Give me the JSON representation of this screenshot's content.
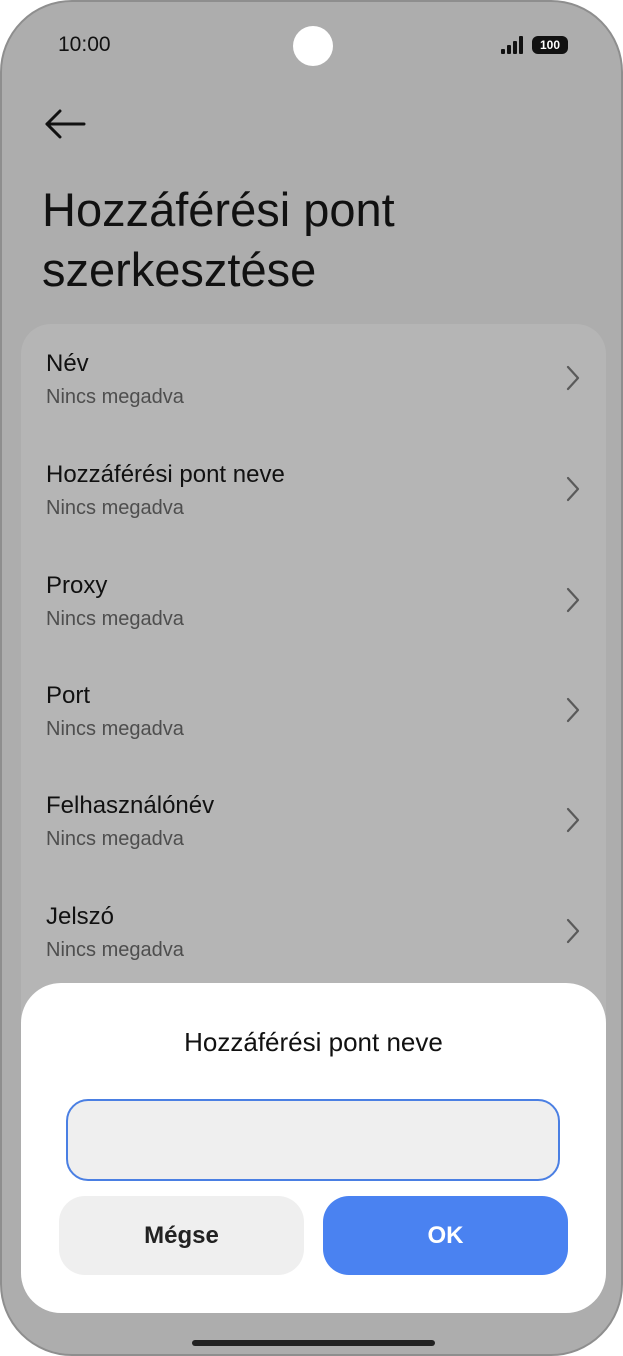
{
  "status_bar": {
    "time": "10:00",
    "battery": "100"
  },
  "page": {
    "back_icon": "arrow-left-icon",
    "title": "Hozzáférési pont szerkesztése"
  },
  "settings": {
    "items": [
      {
        "label": "Név",
        "value": "Nincs megadva"
      },
      {
        "label": "Hozzáférési pont neve",
        "value": "Nincs megadva"
      },
      {
        "label": "Proxy",
        "value": "Nincs megadva"
      },
      {
        "label": "Port",
        "value": "Nincs megadva"
      },
      {
        "label": "Felhasználónév",
        "value": "Nincs megadva"
      },
      {
        "label": "Jelszó",
        "value": "Nincs megadva"
      }
    ],
    "chevron_icon": "chevron-right-icon"
  },
  "dialog": {
    "title": "Hozzáférési pont neve",
    "input_value": "",
    "cancel_label": "Mégse",
    "ok_label": "OK"
  },
  "colors": {
    "accent": "#4a82f1",
    "scrim": "#adadad",
    "dialog_bg": "#ffffff"
  }
}
